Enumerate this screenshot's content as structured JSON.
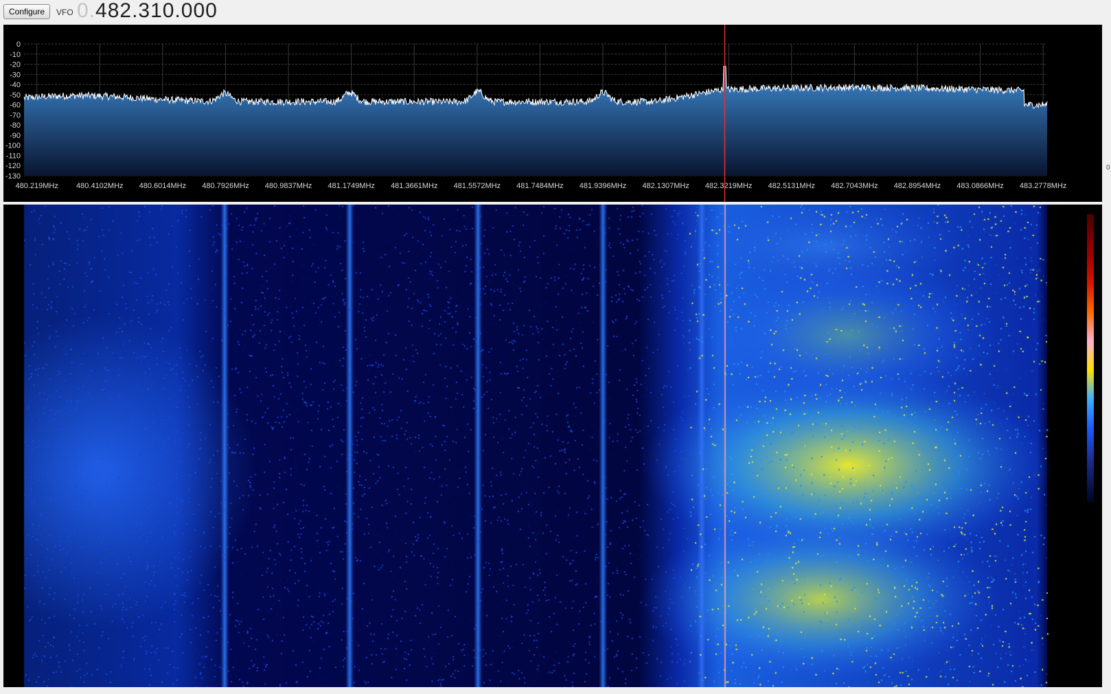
{
  "toolbar": {
    "configure_label": "Configure",
    "vfo_label": "VFO",
    "vfo_leading": "0.",
    "vfo_value": "482.310.000"
  },
  "spectrum": {
    "db_labels": [
      "0",
      "-10",
      "-20",
      "-30",
      "-40",
      "-50",
      "-60",
      "-70",
      "-80",
      "-90",
      "-100",
      "-110",
      "-120",
      "-130"
    ],
    "db_range": [
      -130,
      0
    ],
    "freq_labels": [
      "480.219MHz",
      "480.4102MHz",
      "480.6014MHz",
      "480.7926MHz",
      "480.9837MHz",
      "481.1749MHz",
      "481.3661MHz",
      "481.5572MHz",
      "481.7484MHz",
      "481.9396MHz",
      "482.1307MHz",
      "482.3219MHz",
      "482.5131MHz",
      "482.7043MHz",
      "482.8954MHz",
      "483.0866MHz",
      "483.2778MHz"
    ],
    "freq_range_mhz": [
      480.18,
      483.29
    ],
    "tuned_mhz": 482.31,
    "right_edge_text": "0",
    "trace_color": "#ffffff",
    "fill_top_color": "#3e8ad2",
    "fill_bottom_color": "#0a1530",
    "cursor_color": "#e53030",
    "grid_color": "#3a3a3a",
    "label_color": "#d8d8d8"
  },
  "waterfall": {
    "background_color": "#00004a",
    "cursor_color": "#ffffff"
  }
}
